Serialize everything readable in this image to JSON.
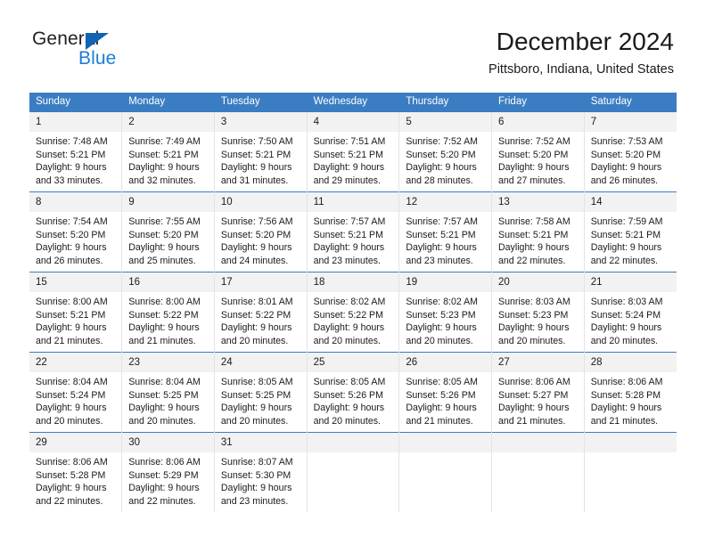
{
  "logo": {
    "word1": "General",
    "word2": "Blue",
    "triangle_color": "#1164b4",
    "word2_color": "#1a7fd4"
  },
  "header": {
    "title": "December 2024",
    "subtitle": "Pittsboro, Indiana, United States"
  },
  "theme": {
    "header_blue": "#3b7dc2",
    "daynum_background": "#f2f2f2",
    "text": "#1a1a1a"
  },
  "weekday_headers": [
    "Sunday",
    "Monday",
    "Tuesday",
    "Wednesday",
    "Thursday",
    "Friday",
    "Saturday"
  ],
  "weeks": [
    [
      {
        "day": "1",
        "sunrise": "Sunrise: 7:48 AM",
        "sunset": "Sunset: 5:21 PM",
        "daylight1": "Daylight: 9 hours",
        "daylight2": "and 33 minutes."
      },
      {
        "day": "2",
        "sunrise": "Sunrise: 7:49 AM",
        "sunset": "Sunset: 5:21 PM",
        "daylight1": "Daylight: 9 hours",
        "daylight2": "and 32 minutes."
      },
      {
        "day": "3",
        "sunrise": "Sunrise: 7:50 AM",
        "sunset": "Sunset: 5:21 PM",
        "daylight1": "Daylight: 9 hours",
        "daylight2": "and 31 minutes."
      },
      {
        "day": "4",
        "sunrise": "Sunrise: 7:51 AM",
        "sunset": "Sunset: 5:21 PM",
        "daylight1": "Daylight: 9 hours",
        "daylight2": "and 29 minutes."
      },
      {
        "day": "5",
        "sunrise": "Sunrise: 7:52 AM",
        "sunset": "Sunset: 5:20 PM",
        "daylight1": "Daylight: 9 hours",
        "daylight2": "and 28 minutes."
      },
      {
        "day": "6",
        "sunrise": "Sunrise: 7:52 AM",
        "sunset": "Sunset: 5:20 PM",
        "daylight1": "Daylight: 9 hours",
        "daylight2": "and 27 minutes."
      },
      {
        "day": "7",
        "sunrise": "Sunrise: 7:53 AM",
        "sunset": "Sunset: 5:20 PM",
        "daylight1": "Daylight: 9 hours",
        "daylight2": "and 26 minutes."
      }
    ],
    [
      {
        "day": "8",
        "sunrise": "Sunrise: 7:54 AM",
        "sunset": "Sunset: 5:20 PM",
        "daylight1": "Daylight: 9 hours",
        "daylight2": "and 26 minutes."
      },
      {
        "day": "9",
        "sunrise": "Sunrise: 7:55 AM",
        "sunset": "Sunset: 5:20 PM",
        "daylight1": "Daylight: 9 hours",
        "daylight2": "and 25 minutes."
      },
      {
        "day": "10",
        "sunrise": "Sunrise: 7:56 AM",
        "sunset": "Sunset: 5:20 PM",
        "daylight1": "Daylight: 9 hours",
        "daylight2": "and 24 minutes."
      },
      {
        "day": "11",
        "sunrise": "Sunrise: 7:57 AM",
        "sunset": "Sunset: 5:21 PM",
        "daylight1": "Daylight: 9 hours",
        "daylight2": "and 23 minutes."
      },
      {
        "day": "12",
        "sunrise": "Sunrise: 7:57 AM",
        "sunset": "Sunset: 5:21 PM",
        "daylight1": "Daylight: 9 hours",
        "daylight2": "and 23 minutes."
      },
      {
        "day": "13",
        "sunrise": "Sunrise: 7:58 AM",
        "sunset": "Sunset: 5:21 PM",
        "daylight1": "Daylight: 9 hours",
        "daylight2": "and 22 minutes."
      },
      {
        "day": "14",
        "sunrise": "Sunrise: 7:59 AM",
        "sunset": "Sunset: 5:21 PM",
        "daylight1": "Daylight: 9 hours",
        "daylight2": "and 22 minutes."
      }
    ],
    [
      {
        "day": "15",
        "sunrise": "Sunrise: 8:00 AM",
        "sunset": "Sunset: 5:21 PM",
        "daylight1": "Daylight: 9 hours",
        "daylight2": "and 21 minutes."
      },
      {
        "day": "16",
        "sunrise": "Sunrise: 8:00 AM",
        "sunset": "Sunset: 5:22 PM",
        "daylight1": "Daylight: 9 hours",
        "daylight2": "and 21 minutes."
      },
      {
        "day": "17",
        "sunrise": "Sunrise: 8:01 AM",
        "sunset": "Sunset: 5:22 PM",
        "daylight1": "Daylight: 9 hours",
        "daylight2": "and 20 minutes."
      },
      {
        "day": "18",
        "sunrise": "Sunrise: 8:02 AM",
        "sunset": "Sunset: 5:22 PM",
        "daylight1": "Daylight: 9 hours",
        "daylight2": "and 20 minutes."
      },
      {
        "day": "19",
        "sunrise": "Sunrise: 8:02 AM",
        "sunset": "Sunset: 5:23 PM",
        "daylight1": "Daylight: 9 hours",
        "daylight2": "and 20 minutes."
      },
      {
        "day": "20",
        "sunrise": "Sunrise: 8:03 AM",
        "sunset": "Sunset: 5:23 PM",
        "daylight1": "Daylight: 9 hours",
        "daylight2": "and 20 minutes."
      },
      {
        "day": "21",
        "sunrise": "Sunrise: 8:03 AM",
        "sunset": "Sunset: 5:24 PM",
        "daylight1": "Daylight: 9 hours",
        "daylight2": "and 20 minutes."
      }
    ],
    [
      {
        "day": "22",
        "sunrise": "Sunrise: 8:04 AM",
        "sunset": "Sunset: 5:24 PM",
        "daylight1": "Daylight: 9 hours",
        "daylight2": "and 20 minutes."
      },
      {
        "day": "23",
        "sunrise": "Sunrise: 8:04 AM",
        "sunset": "Sunset: 5:25 PM",
        "daylight1": "Daylight: 9 hours",
        "daylight2": "and 20 minutes."
      },
      {
        "day": "24",
        "sunrise": "Sunrise: 8:05 AM",
        "sunset": "Sunset: 5:25 PM",
        "daylight1": "Daylight: 9 hours",
        "daylight2": "and 20 minutes."
      },
      {
        "day": "25",
        "sunrise": "Sunrise: 8:05 AM",
        "sunset": "Sunset: 5:26 PM",
        "daylight1": "Daylight: 9 hours",
        "daylight2": "and 20 minutes."
      },
      {
        "day": "26",
        "sunrise": "Sunrise: 8:05 AM",
        "sunset": "Sunset: 5:26 PM",
        "daylight1": "Daylight: 9 hours",
        "daylight2": "and 21 minutes."
      },
      {
        "day": "27",
        "sunrise": "Sunrise: 8:06 AM",
        "sunset": "Sunset: 5:27 PM",
        "daylight1": "Daylight: 9 hours",
        "daylight2": "and 21 minutes."
      },
      {
        "day": "28",
        "sunrise": "Sunrise: 8:06 AM",
        "sunset": "Sunset: 5:28 PM",
        "daylight1": "Daylight: 9 hours",
        "daylight2": "and 21 minutes."
      }
    ],
    [
      {
        "day": "29",
        "sunrise": "Sunrise: 8:06 AM",
        "sunset": "Sunset: 5:28 PM",
        "daylight1": "Daylight: 9 hours",
        "daylight2": "and 22 minutes."
      },
      {
        "day": "30",
        "sunrise": "Sunrise: 8:06 AM",
        "sunset": "Sunset: 5:29 PM",
        "daylight1": "Daylight: 9 hours",
        "daylight2": "and 22 minutes."
      },
      {
        "day": "31",
        "sunrise": "Sunrise: 8:07 AM",
        "sunset": "Sunset: 5:30 PM",
        "daylight1": "Daylight: 9 hours",
        "daylight2": "and 23 minutes."
      },
      {
        "day": "",
        "sunrise": "",
        "sunset": "",
        "daylight1": "",
        "daylight2": ""
      },
      {
        "day": "",
        "sunrise": "",
        "sunset": "",
        "daylight1": "",
        "daylight2": ""
      },
      {
        "day": "",
        "sunrise": "",
        "sunset": "",
        "daylight1": "",
        "daylight2": ""
      },
      {
        "day": "",
        "sunrise": "",
        "sunset": "",
        "daylight1": "",
        "daylight2": ""
      }
    ]
  ]
}
